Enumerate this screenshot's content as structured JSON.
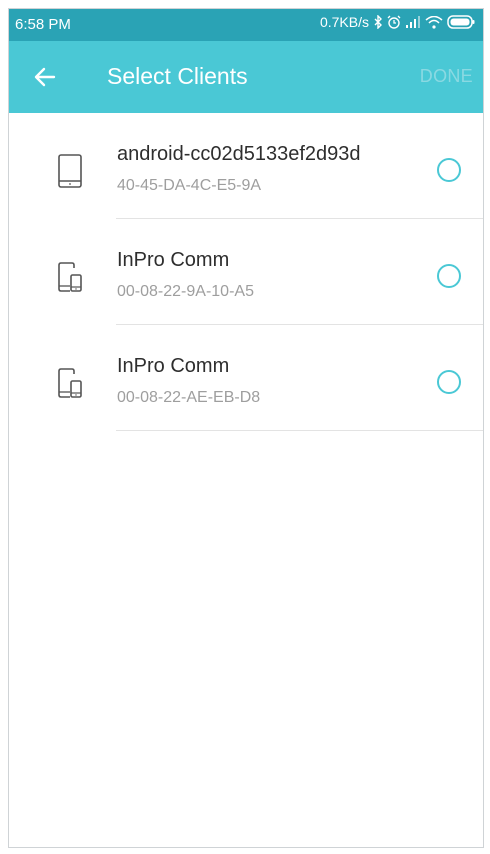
{
  "statusbar": {
    "time": "6:58 PM",
    "speed": "0.7KB/s",
    "icons": [
      "bluetooth-icon",
      "alarm-icon",
      "signal-icon",
      "wifi-icon",
      "battery-icon"
    ]
  },
  "appbar": {
    "title": "Select Clients",
    "done_label": "DONE",
    "back_icon": "arrow-left-icon"
  },
  "clients": [
    {
      "name": "android-cc02d5133ef2d93d",
      "mac": "40-45-DA-4C-E5-9A",
      "icon": "tablet-icon",
      "selected": false
    },
    {
      "name": "InPro Comm",
      "mac": "00-08-22-9A-10-A5",
      "icon": "devices-icon",
      "selected": false
    },
    {
      "name": "InPro Comm",
      "mac": "00-08-22-AE-EB-D8",
      "icon": "devices-icon",
      "selected": false
    }
  ],
  "colors": {
    "statusbar": "#2aa3b5",
    "appbar": "#4ac8d5",
    "accent": "#4ac8d5",
    "done_disabled": "#8ad9e2"
  }
}
